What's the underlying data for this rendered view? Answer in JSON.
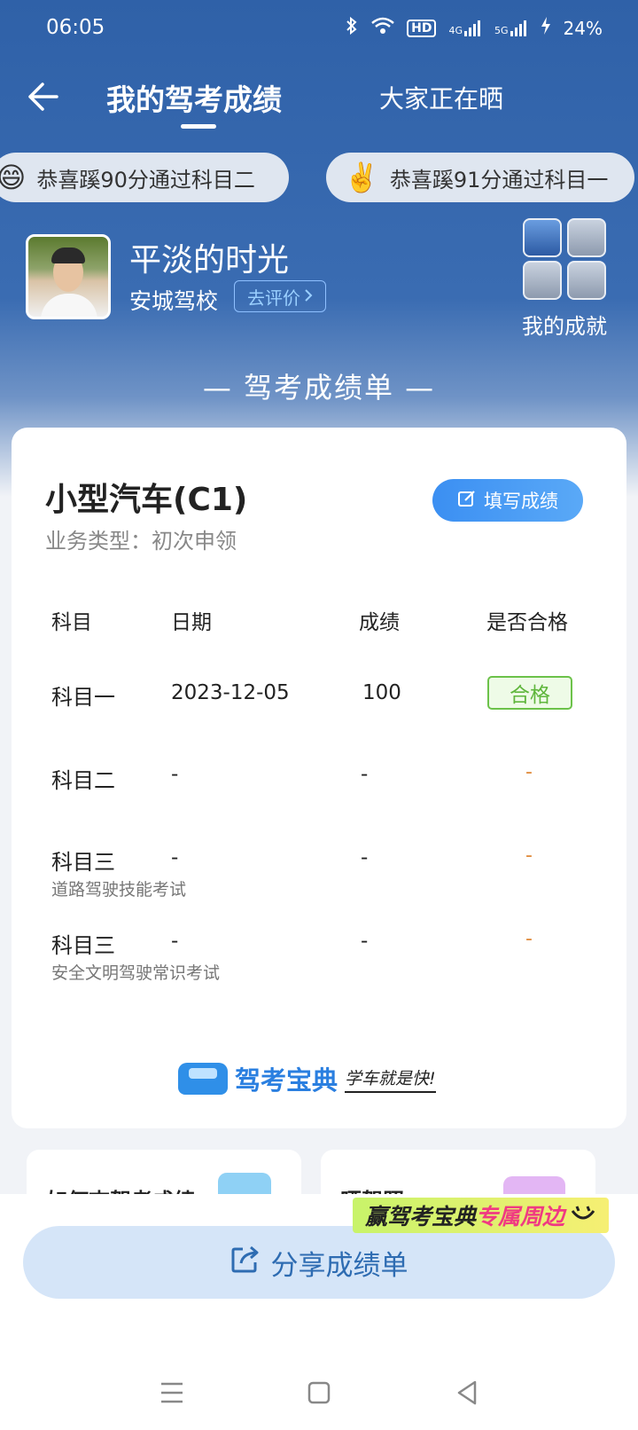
{
  "status_bar": {
    "time": "06:05",
    "network_hd": "HD",
    "net_4g": "4G",
    "net_5g": "5G",
    "battery": "24%"
  },
  "navbar": {
    "title": "我的驾考成绩",
    "other_tab": "大家正在晒"
  },
  "tickers": [
    {
      "emoji": "😄",
      "text": "恭喜蹊90分通过科目二"
    },
    {
      "emoji": "✌️",
      "text": "恭喜蹊91分通过科目一"
    }
  ],
  "profile": {
    "username": "平淡的时光",
    "school": "安城驾校",
    "review_label": "去评价",
    "achievements_label": "我的成就"
  },
  "sheet_title": "— 驾考成绩单 —",
  "card": {
    "car_type": "小型汽车(C1)",
    "business_type": "业务类型：初次申领",
    "fill_button": "填写成绩",
    "headers": [
      "科目",
      "日期",
      "成绩",
      "是否合格"
    ],
    "rows": [
      {
        "subject": "科目一",
        "sub": "",
        "date": "2023-12-05",
        "score": "100",
        "pass": "合格"
      },
      {
        "subject": "科目二",
        "sub": "",
        "date": "-",
        "score": "-",
        "pass": "-"
      },
      {
        "subject": "科目三",
        "sub": "道路驾驶技能考试",
        "date": "-",
        "score": "-",
        "pass": "-"
      },
      {
        "subject": "科目三",
        "sub": "安全文明驾驶常识考试",
        "date": "-",
        "score": "-",
        "pass": "-"
      }
    ],
    "brand_name": "驾考宝典",
    "brand_slogan": "学车就是快!"
  },
  "promos": [
    {
      "text": "如何查驾考成绩"
    },
    {
      "text": "晒驾照"
    }
  ],
  "merch_banner": {
    "prefix": "赢驾考宝典",
    "highlight": "专属周边"
  },
  "share_button": "分享成绩单",
  "colors": {
    "header_blue": "#2f61a8",
    "accent_blue": "#3b8ff2",
    "pass_green": "#5fb63c",
    "dash_orange": "#e08a3a"
  }
}
